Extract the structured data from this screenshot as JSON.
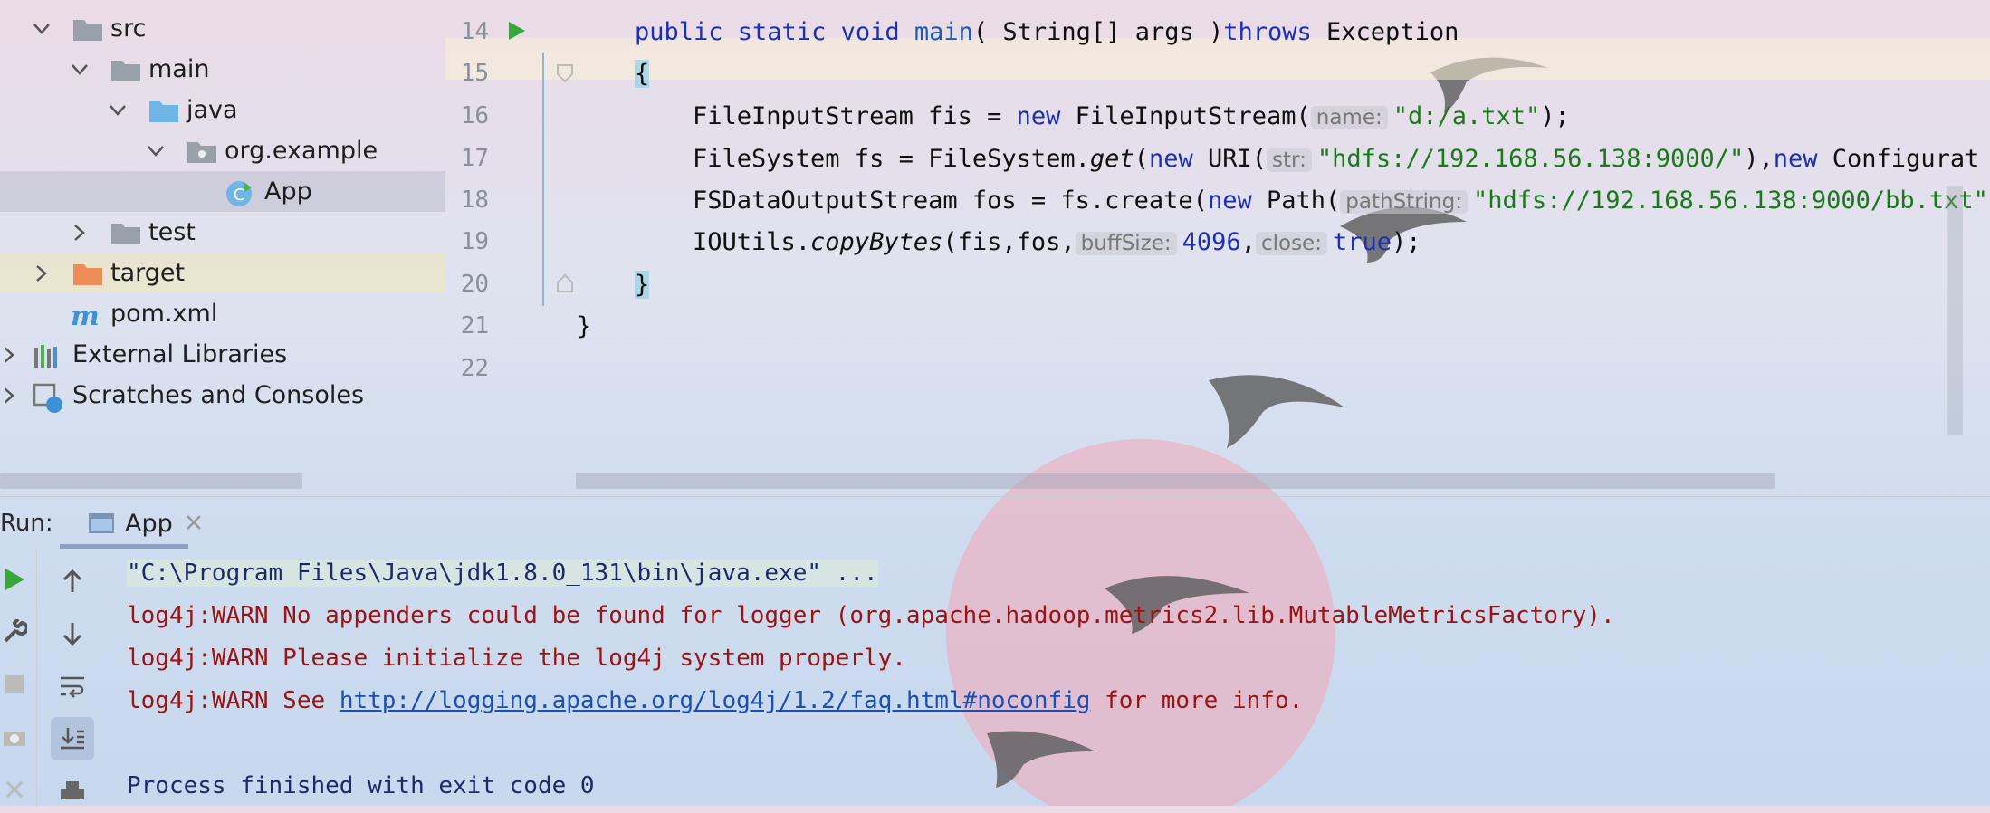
{
  "project_tree": {
    "items": [
      {
        "label": "src",
        "icon": "folder-icon"
      },
      {
        "label": "main",
        "icon": "folder-icon"
      },
      {
        "label": "java",
        "icon": "source-folder-icon"
      },
      {
        "label": "org.example",
        "icon": "package-icon"
      },
      {
        "label": "App",
        "icon": "java-class-icon"
      },
      {
        "label": "test",
        "icon": "folder-icon"
      },
      {
        "label": "target",
        "icon": "excluded-folder-icon"
      },
      {
        "label": "pom.xml",
        "icon": "maven-icon"
      },
      {
        "label": "External Libraries",
        "icon": "libraries-icon"
      },
      {
        "label": "Scratches and Consoles",
        "icon": "scratches-icon"
      }
    ]
  },
  "editor": {
    "line_numbers": [
      "14",
      "15",
      "16",
      "17",
      "18",
      "19",
      "20",
      "21",
      "22"
    ],
    "line14": {
      "kw1": "public static void ",
      "fn": "main",
      "rest": "( String[] args )",
      "kw2": "throws",
      "rest2": " Exception"
    },
    "line15": {
      "brace": "{"
    },
    "line16": {
      "a": "FileInputStream fis = ",
      "kw": "new",
      "b": " FileInputStream(",
      "hint": "name:",
      "str": "\"d:/a.txt\"",
      "c": ");"
    },
    "line17": {
      "a": "FileSystem fs = FileSystem.",
      "m": "get",
      "b": "(",
      "kw": "new",
      "c": " URI(",
      "hint": "str:",
      "str": "\"hdfs://192.168.56.138:9000/\"",
      "d": "),",
      "kw2": "new",
      "e": " Configurat"
    },
    "line18": {
      "a": "FSDataOutputStream fos = fs.create(",
      "kw": "new",
      "b": " Path(",
      "hint": "pathString:",
      "str": "\"hdfs://192.168.56.138:9000/bb.txt\""
    },
    "line19": {
      "a": "IOUtils.",
      "m": "copyBytes",
      "b": "(fis,fos,",
      "hint1": "buffSize:",
      "num": "4096",
      "c": ",",
      "hint2": "close:",
      "kw": "true",
      "d": ");"
    },
    "line20": {
      "brace": "}"
    },
    "line21": {
      "brace": "}"
    }
  },
  "run": {
    "label": "Run:",
    "tab": "App",
    "console": {
      "cmd": "\"C:\\Program Files\\Java\\jdk1.8.0_131\\bin\\java.exe\" ...",
      "warn1": "log4j:WARN No appenders could be found for logger (org.apache.hadoop.metrics2.lib.MutableMetricsFactory).",
      "warn2": "log4j:WARN Please initialize the log4j system properly.",
      "warn3_prefix": "log4j:WARN See ",
      "warn3_link": "http://logging.apache.org/log4j/1.2/faq.html#noconfig",
      "warn3_suffix": " for more info.",
      "exit": "Process finished with exit code 0"
    }
  },
  "colors": {
    "keyword": "#1d2fb8",
    "string": "#1a7a1a",
    "warn": "#9b1313",
    "link": "#1a4fb8"
  }
}
